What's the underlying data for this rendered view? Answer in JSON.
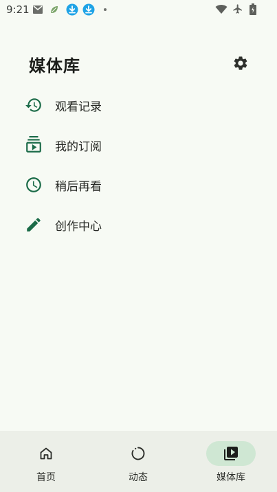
{
  "status_bar": {
    "time": "9:21"
  },
  "header": {
    "title": "媒体库"
  },
  "menu": [
    {
      "label": "观看记录"
    },
    {
      "label": "我的订阅"
    },
    {
      "label": "稍后再看"
    },
    {
      "label": "创作中心"
    }
  ],
  "bottom_nav": {
    "items": [
      {
        "label": "首页"
      },
      {
        "label": "动态"
      },
      {
        "label": "媒体库"
      }
    ],
    "active": "媒体库"
  },
  "colors": {
    "accent": "#1b6b48",
    "active_pill": "#cfe7d3",
    "background": "#f7faf4",
    "nav_background": "#ecefe8"
  }
}
